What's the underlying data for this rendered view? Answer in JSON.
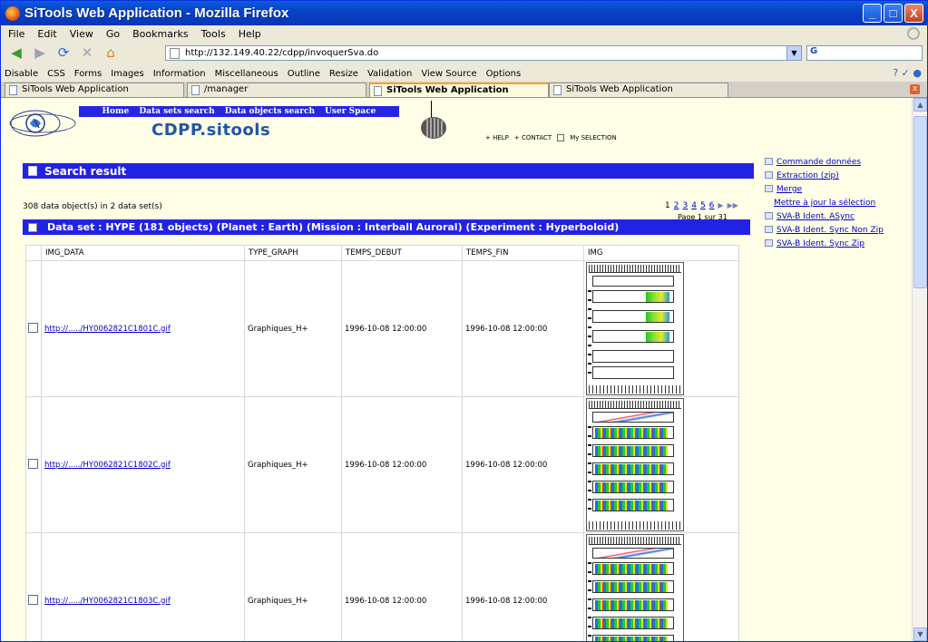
{
  "window": {
    "title": "SiTools Web Application - Mozilla Firefox",
    "min": "_",
    "max": "□",
    "close": "X"
  },
  "menu": [
    "File",
    "Edit",
    "View",
    "Go",
    "Bookmarks",
    "Tools",
    "Help"
  ],
  "nav": {
    "back": "◀",
    "forward": "▶",
    "reload": "⟳",
    "stop": "✕",
    "home": "⌂",
    "url": "http://132.149.40.22/cdpp/invoquerSva.do",
    "dropdown": "▼",
    "search_prefix": "G"
  },
  "devbar": [
    "Disable",
    "CSS",
    "Forms",
    "Images",
    "Information",
    "Miscellaneous",
    "Outline",
    "Resize",
    "Validation",
    "View Source",
    "Options"
  ],
  "tabs": [
    {
      "label": "SiTools Web Application",
      "active": false
    },
    {
      "label": "/manager",
      "active": false
    },
    {
      "label": "SiTools Web Application",
      "active": true
    },
    {
      "label": "SiTools Web Application",
      "active": false
    }
  ],
  "site": {
    "nav": [
      "Home",
      "Data sets search",
      "Data objects search",
      "User Space"
    ],
    "brand": "CDPP.sitools",
    "help": "+ HELP",
    "contact": "+ CONTACT",
    "selection": "My SELECTION"
  },
  "result": {
    "title": "Search result",
    "count": "308 data object(s) in 2 data set(s)",
    "pages": [
      "1",
      "2",
      "3",
      "4",
      "5",
      "6"
    ],
    "next": "▶",
    "last": "▶▶",
    "page_label": "Page 1 sur 31",
    "dataset": "Data set : HYPE  (181 objects)  (Planet : Earth)  (Mission : Interball Auroral)  (Experiment : Hyperboloid)"
  },
  "table": {
    "headers": [
      "IMG_DATA",
      "TYPE_GRAPH",
      "TEMPS_DEBUT",
      "TEMPS_FIN",
      "IMG"
    ],
    "rows": [
      {
        "img": "http://...../HY0062821C1801C.gif",
        "type": "Graphiques_H+",
        "debut": "1996-10-08 12:00:00",
        "fin": "1996-10-08 12:00:00"
      },
      {
        "img": "http://...../HY0062821C1802C.gif",
        "type": "Graphiques_H+",
        "debut": "1996-10-08 12:00:00",
        "fin": "1996-10-08 12:00:00"
      },
      {
        "img": "http://...../HY0062821C1803C.gif",
        "type": "Graphiques_H+",
        "debut": "1996-10-08 12:00:00",
        "fin": "1996-10-08 12:00:00"
      }
    ]
  },
  "actions": [
    "Commande données",
    "Extraction (zip)",
    "Merge",
    "Mettre à jour la sélection",
    "SVA-B Ident. ASync",
    "SVA-B Ident. Sync Non Zip",
    "SVA-B Ident. Sync Zip"
  ]
}
